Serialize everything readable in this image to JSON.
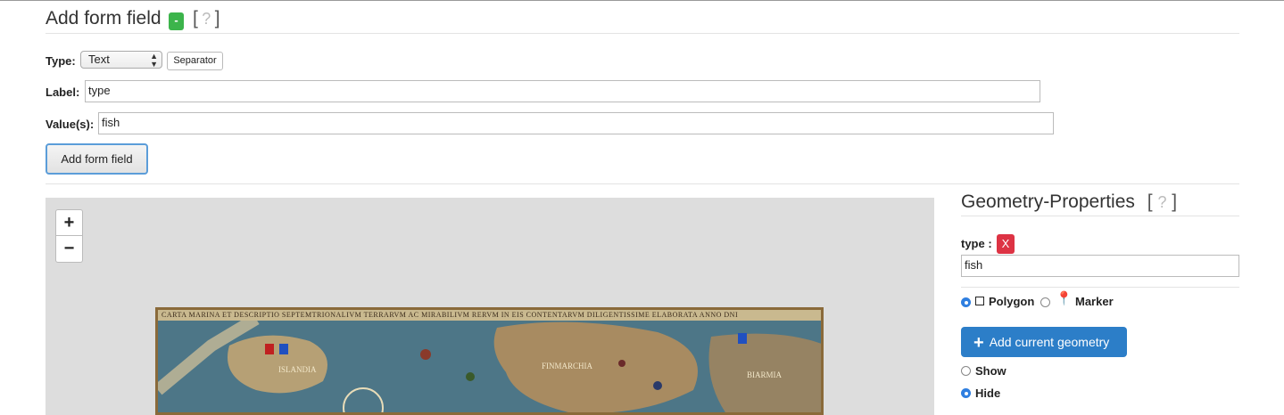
{
  "header": {
    "title": "Add form field",
    "toggle_label": "-",
    "help_open": "[",
    "help_q": "?",
    "help_close": "]"
  },
  "form": {
    "type_label": "Type:",
    "type_value": "Text",
    "separator_label": "Separator",
    "label_label": "Label:",
    "label_value": "type",
    "values_label": "Value(s):",
    "values_value": "fish",
    "add_button": "Add form field"
  },
  "map": {
    "zoom_in": "+",
    "zoom_out": "−",
    "banner": "CARTA MARINA ET DESCRIPTIO SEPTEMTRIONALIVM TERRARVM AC MIRABILIVM RERVM IN EIS CONTENTARVM DILIGENTISSIME ELABORATA ANNO DNI",
    "labels": [
      "ISLANDIA",
      "FINMARCHIA",
      "BIARMIA"
    ]
  },
  "panel": {
    "title": "Geometry-Properties",
    "help_open": "[",
    "help_q": "?",
    "help_close": "]",
    "prop_label": "type :",
    "remove_label": "X",
    "prop_value": "fish",
    "polygon_label": "Polygon",
    "marker_label": "Marker",
    "add_geometry": "Add current geometry",
    "show_label": "Show",
    "hide_label": "Hide"
  },
  "colors": {
    "toggle": "#3cb44b",
    "remove": "#dd3344",
    "primary": "#2c7ec8",
    "radio_selected": "#2f7fe0"
  }
}
